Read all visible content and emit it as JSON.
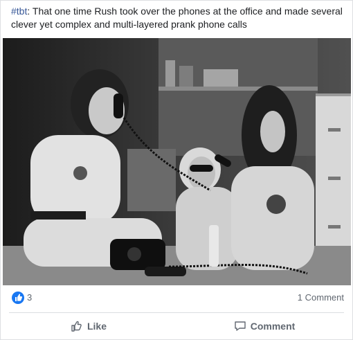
{
  "post": {
    "caption_hashtag": "#tbt",
    "caption_text": ": That one time Rush took over the phones at the office and made several clever yet complex and multi-layered prank phone calls",
    "photo_icon": "photo-image",
    "reactions": {
      "icon": "thumbs-up-icon",
      "count": "3"
    },
    "comments_label": "1 Comment",
    "actions": {
      "like_label": "Like",
      "comment_label": "Comment"
    }
  },
  "colors": {
    "link": "#385898",
    "accent": "#1877f2",
    "secondary_text": "#606770"
  }
}
